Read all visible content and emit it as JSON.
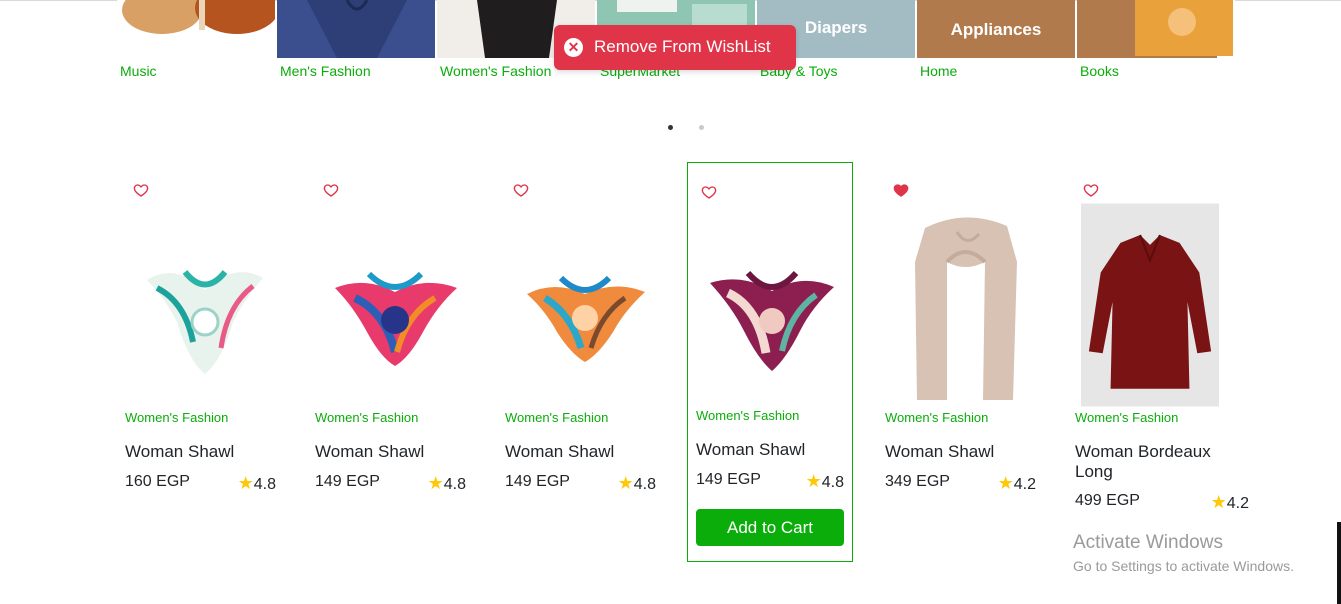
{
  "toast": {
    "message": "Remove From WishList",
    "close_symbol": "✕",
    "color": "#e03448"
  },
  "categories": [
    {
      "name": "Music",
      "image_text": ""
    },
    {
      "name": "Men's Fashion",
      "image_text": ""
    },
    {
      "name": "Women's Fashion",
      "image_text": ""
    },
    {
      "name": "SuperMarket",
      "image_text": ""
    },
    {
      "name": "Baby & Toys",
      "image_text": "Diapers"
    },
    {
      "name": "Home",
      "image_text": "Appliances"
    },
    {
      "name": "Books",
      "image_text": ""
    }
  ],
  "carousel": {
    "pages": 2,
    "active_index": 0
  },
  "products": [
    {
      "category": "Women's Fashion",
      "title": "Woman Shawl",
      "price": "160 EGP",
      "rating": "4.8",
      "wishlisted": false
    },
    {
      "category": "Women's Fashion",
      "title": "Woman Shawl",
      "price": "149 EGP",
      "rating": "4.8",
      "wishlisted": false
    },
    {
      "category": "Women's Fashion",
      "title": "Woman Shawl",
      "price": "149 EGP",
      "rating": "4.8",
      "wishlisted": false
    },
    {
      "category": "Women's Fashion",
      "title": "Woman Shawl",
      "price": "149 EGP",
      "rating": "4.8",
      "wishlisted": false,
      "add_to_cart_label": "Add to Cart"
    },
    {
      "category": "Women's Fashion",
      "title": "Woman Shawl",
      "price": "349 EGP",
      "rating": "4.2",
      "wishlisted": true
    },
    {
      "category": "Women's Fashion",
      "title": "Woman Bordeaux Long",
      "price": "499 EGP",
      "rating": "4.2",
      "wishlisted": false
    }
  ],
  "windows_watermark": {
    "line1": "Activate Windows",
    "line2": "Go to Settings to activate Windows."
  },
  "colors": {
    "accent": "#0aad0a",
    "heart": "#e03448",
    "star": "#ffc908"
  }
}
